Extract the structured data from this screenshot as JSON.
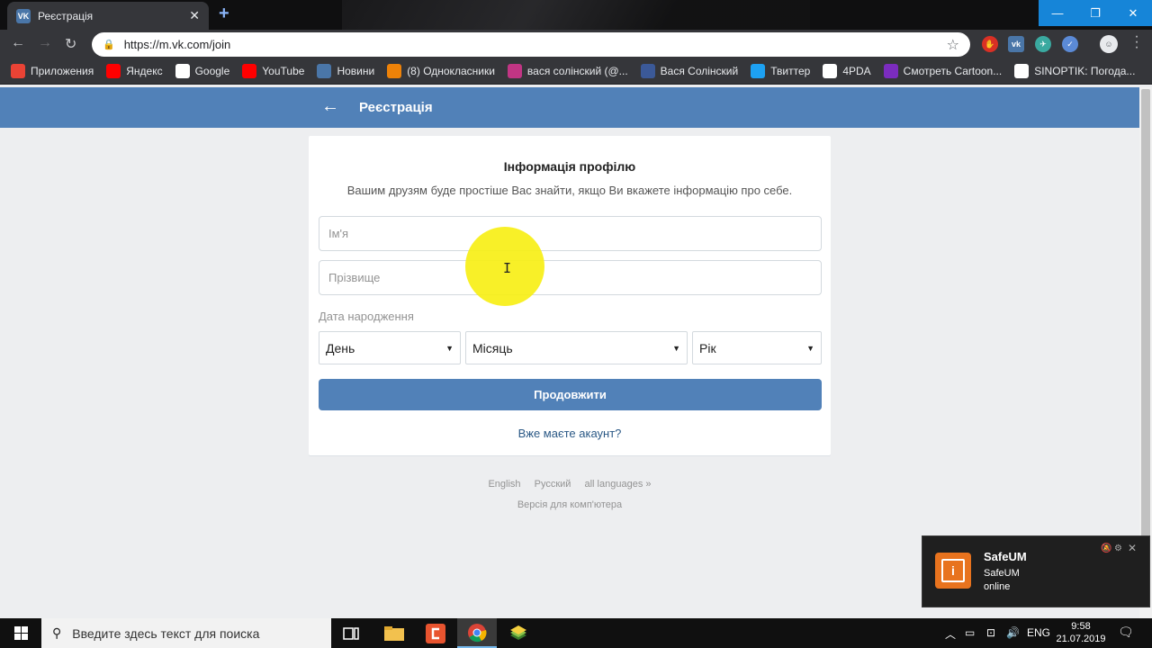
{
  "browser": {
    "tab_title": "Реєстрація",
    "url": "https://m.vk.com/join",
    "bookmarks": [
      {
        "label": "Приложения",
        "icon": "apps-grid-icon",
        "color": "#ea4335"
      },
      {
        "label": "Яндекс",
        "icon": "yandex-icon",
        "color": "#ff0000"
      },
      {
        "label": "Google",
        "icon": "google-icon",
        "color": "#ffffff"
      },
      {
        "label": "YouTube",
        "icon": "youtube-icon",
        "color": "#ff0000"
      },
      {
        "label": "Новини",
        "icon": "news-icon",
        "color": "#4a76a8"
      },
      {
        "label": "(8) Однокласники",
        "icon": "odnoklassniki-icon",
        "color": "#ee8208"
      },
      {
        "label": "вася солінский (@...",
        "icon": "instagram-icon",
        "color": "#c13584"
      },
      {
        "label": "Вася Солінский",
        "icon": "facebook-icon",
        "color": "#3b5998"
      },
      {
        "label": "Твиттер",
        "icon": "twitter-icon",
        "color": "#1da1f2"
      },
      {
        "label": "4PDA",
        "icon": "4pda-icon",
        "color": "#ffffff"
      },
      {
        "label": "Смотреть Cartoon...",
        "icon": "cartoon-icon",
        "color": "#7b2cbf"
      },
      {
        "label": "SINOPTIK: Погода...",
        "icon": "sinoptik-icon",
        "color": "#ffffff"
      }
    ]
  },
  "header": {
    "title": "Реєстрація"
  },
  "form": {
    "heading": "Інформація профілю",
    "subtitle": "Вашим друзям буде простіше Вас знайти, якщо Ви вкажете інформацію про себе.",
    "first_name_placeholder": "Ім'я",
    "last_name_placeholder": "Прізвище",
    "dob_label": "Дата народження",
    "day": "День",
    "month": "Місяць",
    "year": "Рік",
    "continue_label": "Продовжити",
    "have_account": "Вже маєте акаунт?"
  },
  "footer": {
    "languages": [
      "English",
      "Русский",
      "all languages »"
    ],
    "desktop_version": "Версія для комп'ютера"
  },
  "notification": {
    "title": "SafeUM",
    "line1": "SafeUM",
    "line2": "online"
  },
  "taskbar": {
    "search_placeholder": "Введите здесь текст для поиска",
    "lang": "ENG",
    "time": "9:58",
    "date": "21.07.2019"
  },
  "colors": {
    "vk_blue": "#5181b8",
    "link_blue": "#2a5885",
    "page_bg": "#edeef0"
  }
}
